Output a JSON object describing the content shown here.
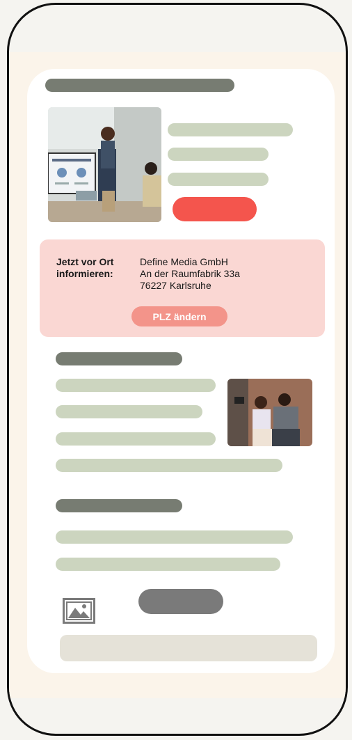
{
  "info_box": {
    "label_line1": "Jetzt vor Ort",
    "label_line2": "informieren:",
    "company": "Define Media GmbH",
    "street": "An der Raumfabrik 33a",
    "city": "76227 Karlsruhe",
    "button_label": "PLZ ändern"
  },
  "icons": {
    "placeholder_image": "image-icon"
  },
  "colors": {
    "accent_red": "#f4554d",
    "info_bg": "#fad7d3",
    "plz_button": "#f3948a",
    "dark_placeholder": "#777c72",
    "green_placeholder": "#ccd5bf"
  }
}
